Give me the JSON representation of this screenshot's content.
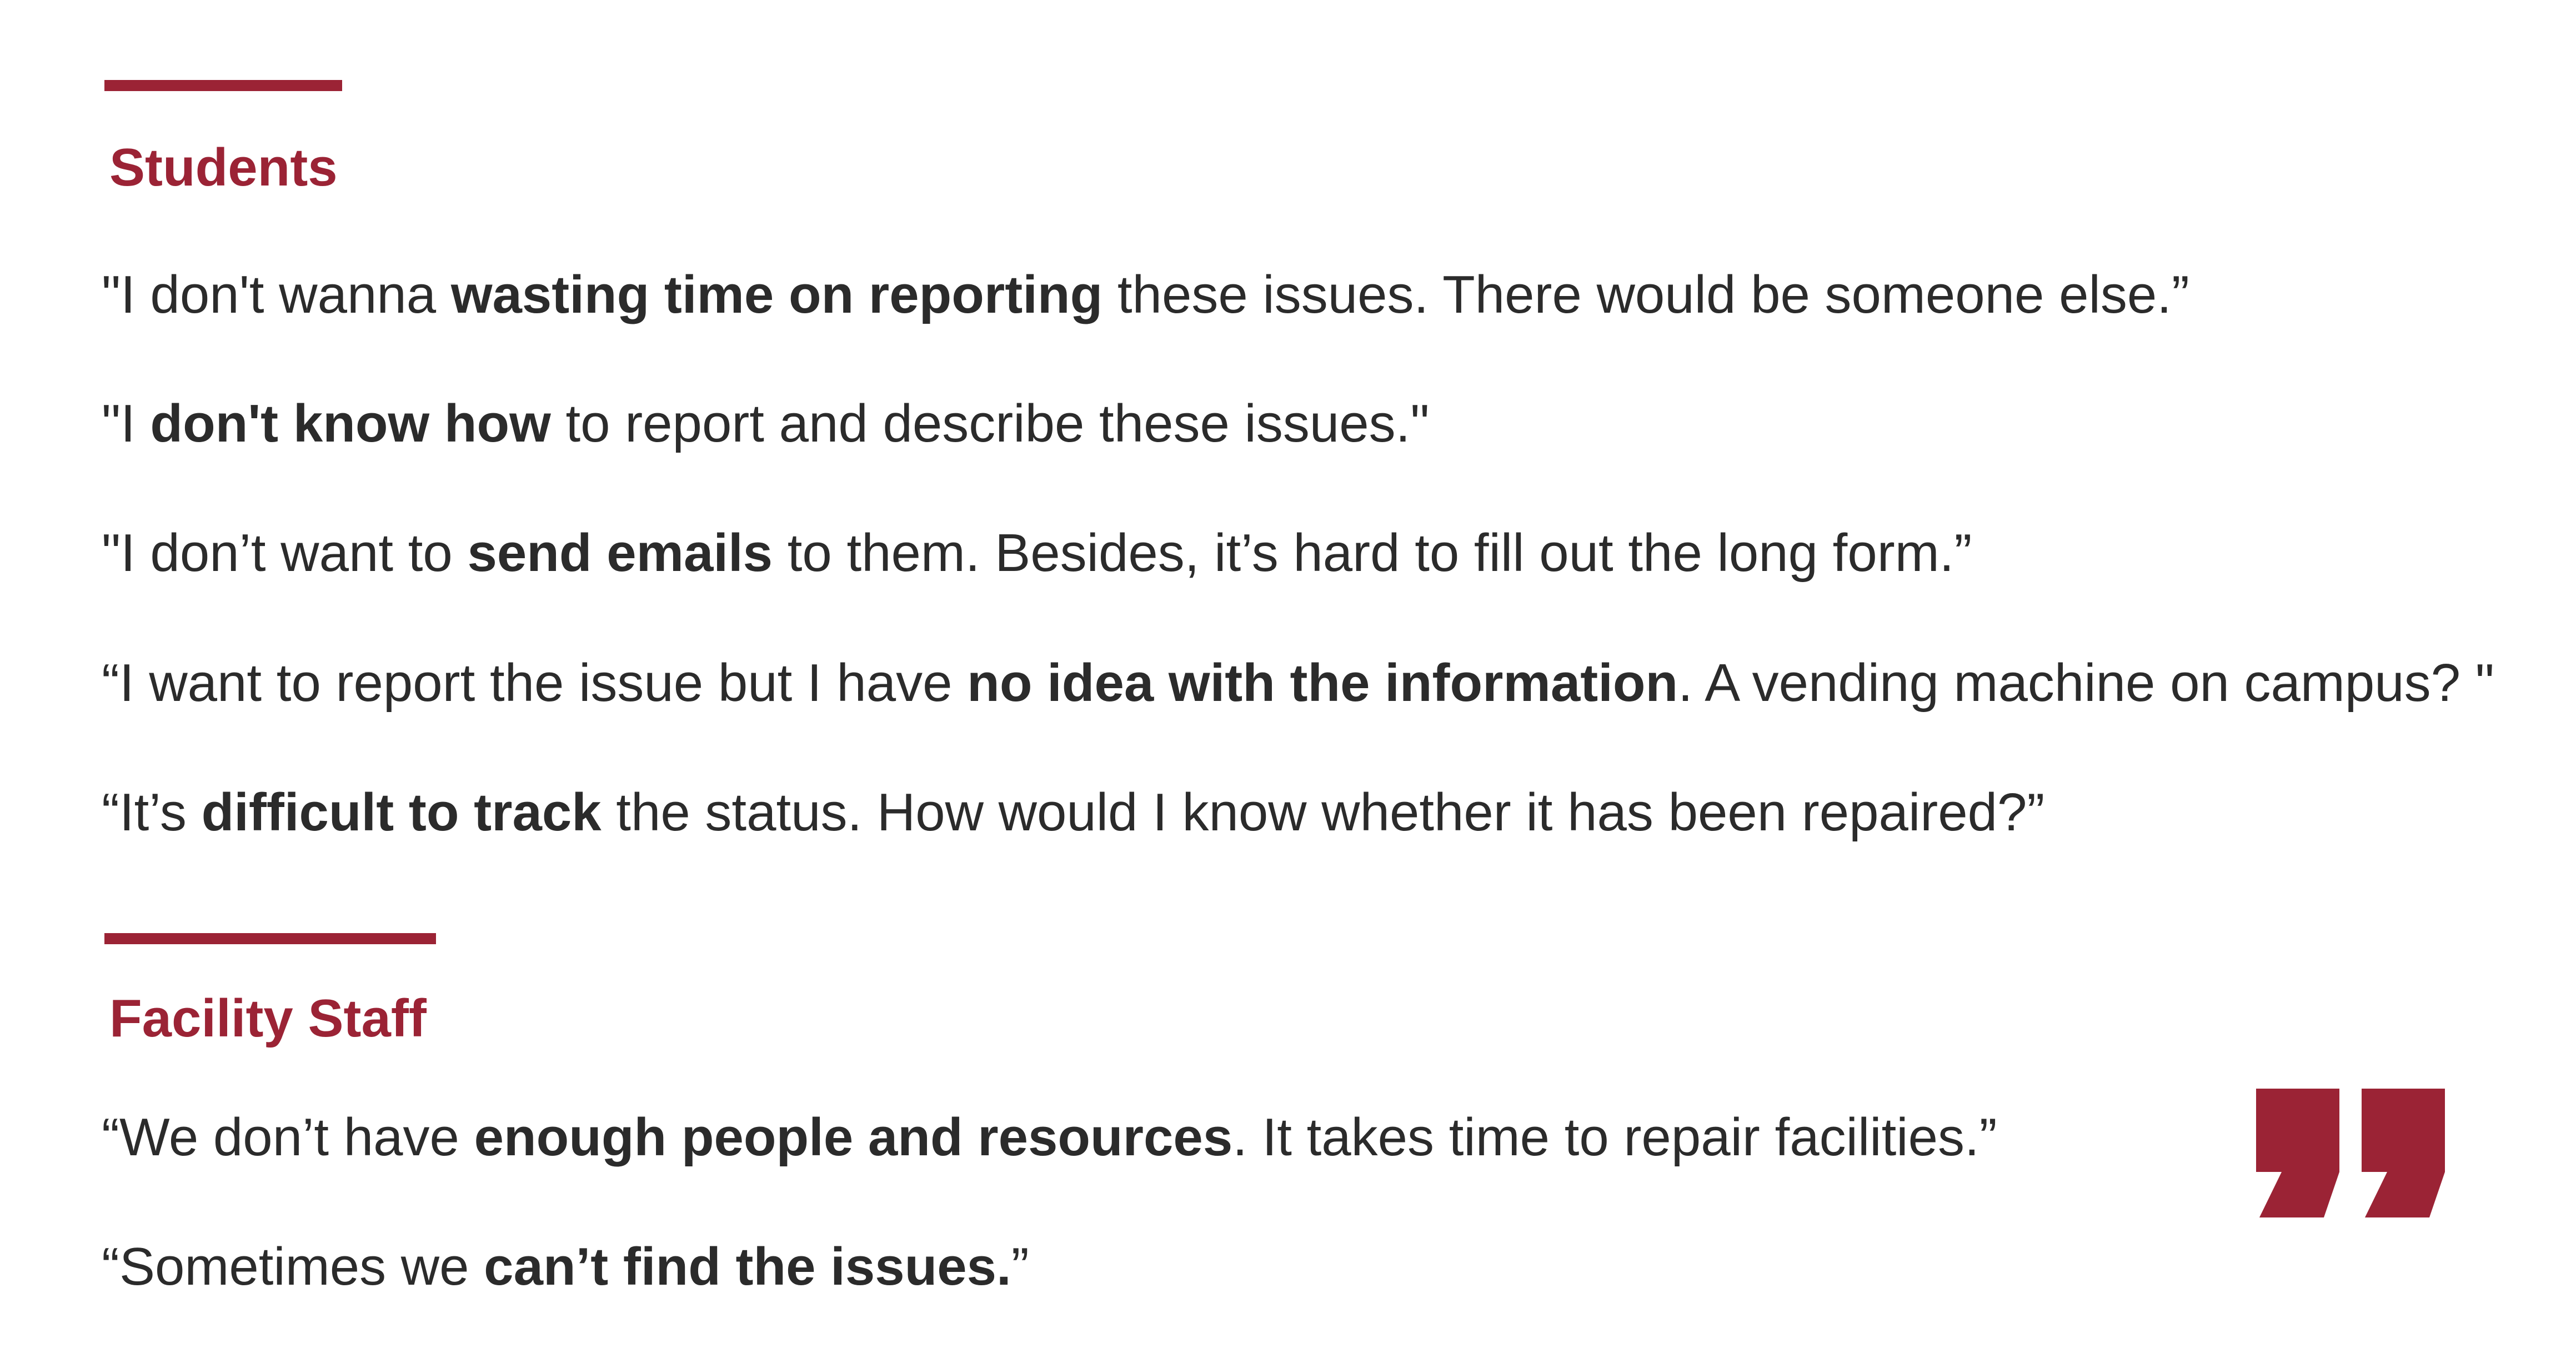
{
  "colors": {
    "accent": "#9b2335",
    "text": "#2b2b2b",
    "background": "#ffffff"
  },
  "sections": [
    {
      "title": "Students",
      "quotes": [
        {
          "segments": [
            {
              "text": "\"I don't wanna ",
              "bold": false
            },
            {
              "text": "wasting time on reporting",
              "bold": true
            },
            {
              "text": " these issues. There would be someone else.”",
              "bold": false
            }
          ]
        },
        {
          "segments": [
            {
              "text": "\"I ",
              "bold": false
            },
            {
              "text": "don't know how",
              "bold": true
            },
            {
              "text": " to report and describe these issues.\"",
              "bold": false
            }
          ]
        },
        {
          "segments": [
            {
              "text": "\"I don’t want to ",
              "bold": false
            },
            {
              "text": "send emails",
              "bold": true
            },
            {
              "text": " to them. Besides, it’s hard to fill out the long form.”",
              "bold": false
            }
          ]
        },
        {
          "segments": [
            {
              "text": "“I want to report the issue but I have ",
              "bold": false
            },
            {
              "text": "no idea with the information",
              "bold": true
            },
            {
              "text": ". A vending machine on campus? \"",
              "bold": false
            }
          ]
        },
        {
          "segments": [
            {
              "text": "“It’s ",
              "bold": false
            },
            {
              "text": "difficult to track",
              "bold": true
            },
            {
              "text": " the status. How would I know whether it has been repaired?”",
              "bold": false
            }
          ]
        }
      ]
    },
    {
      "title": "Facility Staff",
      "quotes": [
        {
          "segments": [
            {
              "text": "“We don’t have ",
              "bold": false
            },
            {
              "text": "enough people and resources",
              "bold": true
            },
            {
              "text": ". It takes time to repair facilities.”",
              "bold": false
            }
          ]
        },
        {
          "segments": [
            {
              "text": "“Sometimes we ",
              "bold": false
            },
            {
              "text": "can’t find the issues.",
              "bold": true
            },
            {
              "text": "”",
              "bold": false
            }
          ]
        }
      ]
    }
  ],
  "decoration": {
    "icon": "closing-quote-icon"
  }
}
